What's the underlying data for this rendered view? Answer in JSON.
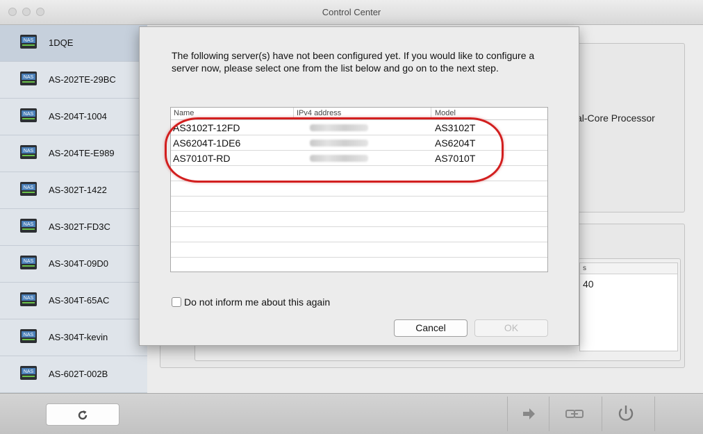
{
  "window": {
    "title": "Control Center"
  },
  "sidebar": {
    "items": [
      {
        "label": "1DQE",
        "selected": true
      },
      {
        "label": "AS-202TE-29BC"
      },
      {
        "label": "AS-204T-1004"
      },
      {
        "label": "AS-204TE-E989"
      },
      {
        "label": "AS-302T-1422"
      },
      {
        "label": "AS-302T-FD3C"
      },
      {
        "label": "AS-304T-09D0"
      },
      {
        "label": "AS-304T-65AC"
      },
      {
        "label": "AS-304T-kevin"
      },
      {
        "label": "AS-602T-002B"
      }
    ],
    "icon_badge": "NAS"
  },
  "background": {
    "processor_text": "al-Core Processor",
    "mini_table_header": "s",
    "mini_table_value": "40"
  },
  "dialog": {
    "message": "The following server(s) have not been configured yet. If you would like to configure a server now, please select one from the list below and go on to the next step.",
    "table": {
      "columns": [
        "Name",
        "IPv4 address",
        "Model"
      ],
      "rows": [
        {
          "name": "AS3102T-12FD",
          "model": "AS3102T"
        },
        {
          "name": "AS6204T-1DE6",
          "model": "AS6204T"
        },
        {
          "name": "AS7010T-RD",
          "model": "AS7010T"
        }
      ]
    },
    "checkbox_label": "Do not inform me about this again",
    "cancel_label": "Cancel",
    "ok_label": "OK",
    "highlight_color": "#d21f1f"
  },
  "toolbar": {
    "icons": [
      "refresh-icon",
      "arrow-right-icon",
      "link-icon",
      "power-icon"
    ]
  }
}
